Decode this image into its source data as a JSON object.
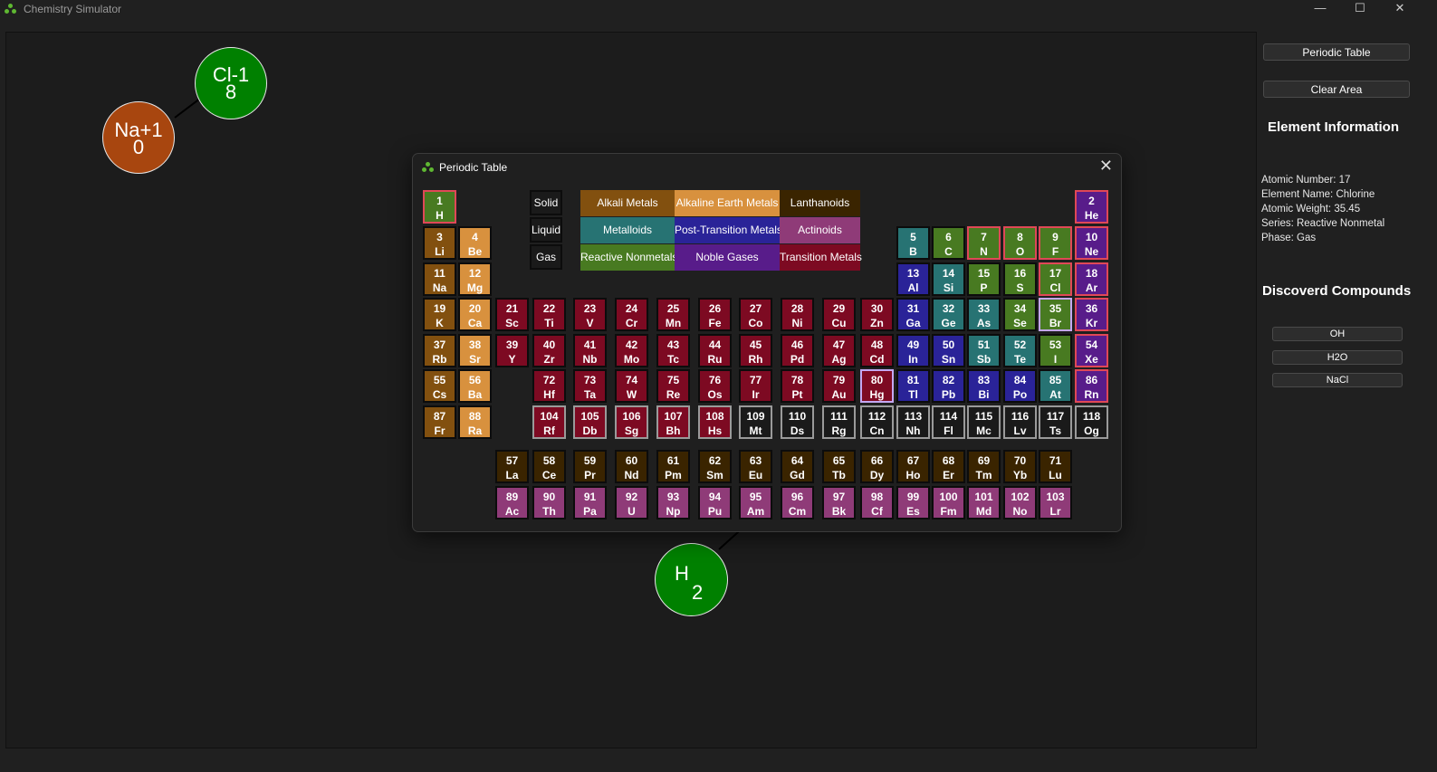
{
  "window": {
    "title": "Chemistry Simulator",
    "minimize": "—",
    "maximize": "☐",
    "close": "✕"
  },
  "sim": {
    "atoms": [
      {
        "label": "Cl-1",
        "sub": "8",
        "color": "#008000"
      },
      {
        "label": "Na+1",
        "sub": "0",
        "color": "#a8460f"
      },
      {
        "label": "H",
        "sub": "2",
        "color": "#008000"
      }
    ]
  },
  "sidebar": {
    "periodic_table_button": "Periodic Table",
    "clear_area_button": "Clear Area",
    "element_info_title": "Element Information",
    "info_lines": [
      "Atomic Number: 17",
      "Element Name: Chlorine",
      "Atomic Weight: 35.45",
      "Series: Reactive Nonmetal",
      "Phase: Gas"
    ],
    "compounds_title": "Discoverd Compounds",
    "compounds": [
      "OH",
      "H2O",
      "NaCl"
    ]
  },
  "dialog": {
    "title": "Periodic Table",
    "close": "✕"
  },
  "phases": [
    "Solid",
    "Liquid",
    "Gas"
  ],
  "legend": [
    {
      "label": "Alkali Metals",
      "color": "#82500f"
    },
    {
      "label": "Alkaline Earth Metals",
      "color": "#d8913e"
    },
    {
      "label": "Lanthanoids",
      "color": "#3a2400"
    },
    {
      "label": "Metalloids",
      "color": "#277373"
    },
    {
      "label": "Post-Transition Metals",
      "color": "#2a2398"
    },
    {
      "label": "Actinoids",
      "color": "#8f3b78"
    },
    {
      "label": "Reactive Nonmetals",
      "color": "#487a21"
    },
    {
      "label": "Noble Gases",
      "color": "#581c8a"
    },
    {
      "label": "Transition Metals",
      "color": "#7d0a22"
    }
  ],
  "elements": [
    {
      "n": "1",
      "s": "H",
      "p": "gas",
      "c": "#487a21"
    },
    {
      "n": "2",
      "s": "He",
      "p": "gas",
      "c": "#581c8a"
    },
    {
      "n": "3",
      "s": "Li",
      "p": "solid",
      "c": "#82500f"
    },
    {
      "n": "4",
      "s": "Be",
      "p": "solid",
      "c": "#d8913e"
    },
    {
      "n": "5",
      "s": "B",
      "p": "solid",
      "c": "#277373"
    },
    {
      "n": "6",
      "s": "C",
      "p": "solid",
      "c": "#487a21"
    },
    {
      "n": "7",
      "s": "N",
      "p": "gas",
      "c": "#487a21"
    },
    {
      "n": "8",
      "s": "O",
      "p": "gas",
      "c": "#487a21"
    },
    {
      "n": "9",
      "s": "F",
      "p": "gas",
      "c": "#487a21"
    },
    {
      "n": "10",
      "s": "Ne",
      "p": "gas",
      "c": "#581c8a"
    },
    {
      "n": "11",
      "s": "Na",
      "p": "solid",
      "c": "#82500f"
    },
    {
      "n": "12",
      "s": "Mg",
      "p": "solid",
      "c": "#d8913e"
    },
    {
      "n": "13",
      "s": "Al",
      "p": "solid",
      "c": "#2a2398"
    },
    {
      "n": "14",
      "s": "Si",
      "p": "solid",
      "c": "#277373"
    },
    {
      "n": "15",
      "s": "P",
      "p": "solid",
      "c": "#487a21"
    },
    {
      "n": "16",
      "s": "S",
      "p": "solid",
      "c": "#487a21"
    },
    {
      "n": "17",
      "s": "Cl",
      "p": "gas",
      "c": "#487a21"
    },
    {
      "n": "18",
      "s": "Ar",
      "p": "gas",
      "c": "#581c8a"
    },
    {
      "n": "19",
      "s": "K",
      "p": "solid",
      "c": "#82500f"
    },
    {
      "n": "20",
      "s": "Ca",
      "p": "solid",
      "c": "#d8913e"
    },
    {
      "n": "21",
      "s": "Sc",
      "p": "solid",
      "c": "#7d0a22"
    },
    {
      "n": "22",
      "s": "Ti",
      "p": "solid",
      "c": "#7d0a22"
    },
    {
      "n": "23",
      "s": "V",
      "p": "solid",
      "c": "#7d0a22"
    },
    {
      "n": "24",
      "s": "Cr",
      "p": "solid",
      "c": "#7d0a22"
    },
    {
      "n": "25",
      "s": "Mn",
      "p": "solid",
      "c": "#7d0a22"
    },
    {
      "n": "26",
      "s": "Fe",
      "p": "solid",
      "c": "#7d0a22"
    },
    {
      "n": "27",
      "s": "Co",
      "p": "solid",
      "c": "#7d0a22"
    },
    {
      "n": "28",
      "s": "Ni",
      "p": "solid",
      "c": "#7d0a22"
    },
    {
      "n": "29",
      "s": "Cu",
      "p": "solid",
      "c": "#7d0a22"
    },
    {
      "n": "30",
      "s": "Zn",
      "p": "solid",
      "c": "#7d0a22"
    },
    {
      "n": "31",
      "s": "Ga",
      "p": "solid",
      "c": "#2a2398"
    },
    {
      "n": "32",
      "s": "Ge",
      "p": "solid",
      "c": "#277373"
    },
    {
      "n": "33",
      "s": "As",
      "p": "solid",
      "c": "#277373"
    },
    {
      "n": "34",
      "s": "Se",
      "p": "solid",
      "c": "#487a21"
    },
    {
      "n": "35",
      "s": "Br",
      "p": "liquid",
      "c": "#487a21"
    },
    {
      "n": "36",
      "s": "Kr",
      "p": "gas",
      "c": "#581c8a"
    },
    {
      "n": "37",
      "s": "Rb",
      "p": "solid",
      "c": "#82500f"
    },
    {
      "n": "38",
      "s": "Sr",
      "p": "solid",
      "c": "#d8913e"
    },
    {
      "n": "39",
      "s": "Y",
      "p": "solid",
      "c": "#7d0a22"
    },
    {
      "n": "40",
      "s": "Zr",
      "p": "solid",
      "c": "#7d0a22"
    },
    {
      "n": "41",
      "s": "Nb",
      "p": "solid",
      "c": "#7d0a22"
    },
    {
      "n": "42",
      "s": "Mo",
      "p": "solid",
      "c": "#7d0a22"
    },
    {
      "n": "43",
      "s": "Tc",
      "p": "solid",
      "c": "#7d0a22"
    },
    {
      "n": "44",
      "s": "Ru",
      "p": "solid",
      "c": "#7d0a22"
    },
    {
      "n": "45",
      "s": "Rh",
      "p": "solid",
      "c": "#7d0a22"
    },
    {
      "n": "46",
      "s": "Pd",
      "p": "solid",
      "c": "#7d0a22"
    },
    {
      "n": "47",
      "s": "Ag",
      "p": "solid",
      "c": "#7d0a22"
    },
    {
      "n": "48",
      "s": "Cd",
      "p": "solid",
      "c": "#7d0a22"
    },
    {
      "n": "49",
      "s": "In",
      "p": "solid",
      "c": "#2a2398"
    },
    {
      "n": "50",
      "s": "Sn",
      "p": "solid",
      "c": "#2a2398"
    },
    {
      "n": "51",
      "s": "Sb",
      "p": "solid",
      "c": "#277373"
    },
    {
      "n": "52",
      "s": "Te",
      "p": "solid",
      "c": "#277373"
    },
    {
      "n": "53",
      "s": "I",
      "p": "solid",
      "c": "#487a21"
    },
    {
      "n": "54",
      "s": "Xe",
      "p": "gas",
      "c": "#581c8a"
    },
    {
      "n": "55",
      "s": "Cs",
      "p": "solid",
      "c": "#82500f"
    },
    {
      "n": "56",
      "s": "Ba",
      "p": "solid",
      "c": "#d8913e"
    },
    {
      "n": "72",
      "s": "Hf",
      "p": "solid",
      "c": "#7d0a22"
    },
    {
      "n": "73",
      "s": "Ta",
      "p": "solid",
      "c": "#7d0a22"
    },
    {
      "n": "74",
      "s": "W",
      "p": "solid",
      "c": "#7d0a22"
    },
    {
      "n": "75",
      "s": "Re",
      "p": "solid",
      "c": "#7d0a22"
    },
    {
      "n": "76",
      "s": "Os",
      "p": "solid",
      "c": "#7d0a22"
    },
    {
      "n": "77",
      "s": "Ir",
      "p": "solid",
      "c": "#7d0a22"
    },
    {
      "n": "78",
      "s": "Pt",
      "p": "solid",
      "c": "#7d0a22"
    },
    {
      "n": "79",
      "s": "Au",
      "p": "solid",
      "c": "#7d0a22"
    },
    {
      "n": "80",
      "s": "Hg",
      "p": "liquid",
      "c": "#7d0a22"
    },
    {
      "n": "81",
      "s": "Tl",
      "p": "solid",
      "c": "#2a2398"
    },
    {
      "n": "82",
      "s": "Pb",
      "p": "solid",
      "c": "#2a2398"
    },
    {
      "n": "83",
      "s": "Bi",
      "p": "solid",
      "c": "#2a2398"
    },
    {
      "n": "84",
      "s": "Po",
      "p": "solid",
      "c": "#2a2398"
    },
    {
      "n": "85",
      "s": "At",
      "p": "solid",
      "c": "#277373"
    },
    {
      "n": "86",
      "s": "Rn",
      "p": "gas",
      "c": "#581c8a"
    },
    {
      "n": "87",
      "s": "Fr",
      "p": "solid",
      "c": "#82500f"
    },
    {
      "n": "88",
      "s": "Ra",
      "p": "solid",
      "c": "#d8913e"
    },
    {
      "n": "104",
      "s": "Rf",
      "p": "syn",
      "c": "#7d0a22"
    },
    {
      "n": "105",
      "s": "Db",
      "p": "syn",
      "c": "#7d0a22"
    },
    {
      "n": "106",
      "s": "Sg",
      "p": "syn",
      "c": "#7d0a22"
    },
    {
      "n": "107",
      "s": "Bh",
      "p": "syn",
      "c": "#7d0a22"
    },
    {
      "n": "108",
      "s": "Hs",
      "p": "syn",
      "c": "#7d0a22"
    },
    {
      "n": "109",
      "s": "Mt",
      "p": "syn",
      "c": "#1a1a1a"
    },
    {
      "n": "110",
      "s": "Ds",
      "p": "syn",
      "c": "#1a1a1a"
    },
    {
      "n": "111",
      "s": "Rg",
      "p": "syn",
      "c": "#1a1a1a"
    },
    {
      "n": "112",
      "s": "Cn",
      "p": "syn",
      "c": "#1a1a1a"
    },
    {
      "n": "113",
      "s": "Nh",
      "p": "syn",
      "c": "#1a1a1a"
    },
    {
      "n": "114",
      "s": "Fl",
      "p": "syn",
      "c": "#1a1a1a"
    },
    {
      "n": "115",
      "s": "Mc",
      "p": "syn",
      "c": "#1a1a1a"
    },
    {
      "n": "116",
      "s": "Lv",
      "p": "syn",
      "c": "#1a1a1a"
    },
    {
      "n": "117",
      "s": "Ts",
      "p": "syn",
      "c": "#1a1a1a"
    },
    {
      "n": "118",
      "s": "Og",
      "p": "syn",
      "c": "#1a1a1a"
    },
    {
      "n": "57",
      "s": "La",
      "p": "solid",
      "c": "#3a2400"
    },
    {
      "n": "58",
      "s": "Ce",
      "p": "solid",
      "c": "#3a2400"
    },
    {
      "n": "59",
      "s": "Pr",
      "p": "solid",
      "c": "#3a2400"
    },
    {
      "n": "60",
      "s": "Nd",
      "p": "solid",
      "c": "#3a2400"
    },
    {
      "n": "61",
      "s": "Pm",
      "p": "solid",
      "c": "#3a2400"
    },
    {
      "n": "62",
      "s": "Sm",
      "p": "solid",
      "c": "#3a2400"
    },
    {
      "n": "63",
      "s": "Eu",
      "p": "solid",
      "c": "#3a2400"
    },
    {
      "n": "64",
      "s": "Gd",
      "p": "solid",
      "c": "#3a2400"
    },
    {
      "n": "65",
      "s": "Tb",
      "p": "solid",
      "c": "#3a2400"
    },
    {
      "n": "66",
      "s": "Dy",
      "p": "solid",
      "c": "#3a2400"
    },
    {
      "n": "67",
      "s": "Ho",
      "p": "solid",
      "c": "#3a2400"
    },
    {
      "n": "68",
      "s": "Er",
      "p": "solid",
      "c": "#3a2400"
    },
    {
      "n": "69",
      "s": "Tm",
      "p": "solid",
      "c": "#3a2400"
    },
    {
      "n": "70",
      "s": "Yb",
      "p": "solid",
      "c": "#3a2400"
    },
    {
      "n": "71",
      "s": "Lu",
      "p": "solid",
      "c": "#3a2400"
    },
    {
      "n": "89",
      "s": "Ac",
      "p": "solid",
      "c": "#8f3b78"
    },
    {
      "n": "90",
      "s": "Th",
      "p": "solid",
      "c": "#8f3b78"
    },
    {
      "n": "91",
      "s": "Pa",
      "p": "solid",
      "c": "#8f3b78"
    },
    {
      "n": "92",
      "s": "U",
      "p": "solid",
      "c": "#8f3b78"
    },
    {
      "n": "93",
      "s": "Np",
      "p": "solid",
      "c": "#8f3b78"
    },
    {
      "n": "94",
      "s": "Pu",
      "p": "solid",
      "c": "#8f3b78"
    },
    {
      "n": "95",
      "s": "Am",
      "p": "solid",
      "c": "#8f3b78"
    },
    {
      "n": "96",
      "s": "Cm",
      "p": "solid",
      "c": "#8f3b78"
    },
    {
      "n": "97",
      "s": "Bk",
      "p": "solid",
      "c": "#8f3b78"
    },
    {
      "n": "98",
      "s": "Cf",
      "p": "solid",
      "c": "#8f3b78"
    },
    {
      "n": "99",
      "s": "Es",
      "p": "solid",
      "c": "#8f3b78"
    },
    {
      "n": "100",
      "s": "Fm",
      "p": "solid",
      "c": "#8f3b78"
    },
    {
      "n": "101",
      "s": "Md",
      "p": "solid",
      "c": "#8f3b78"
    },
    {
      "n": "102",
      "s": "No",
      "p": "solid",
      "c": "#8f3b78"
    },
    {
      "n": "103",
      "s": "Lr",
      "p": "solid",
      "c": "#8f3b78"
    }
  ]
}
